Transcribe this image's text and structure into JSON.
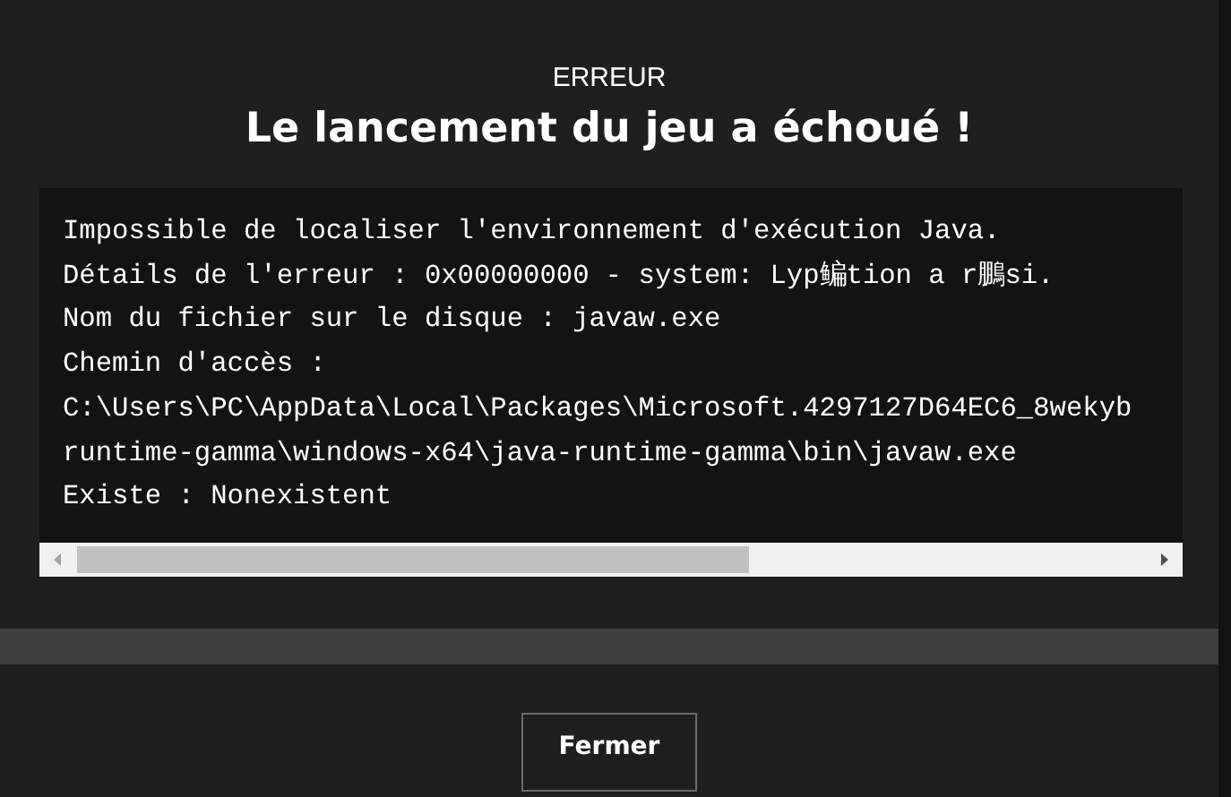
{
  "dialog": {
    "overline": "ERREUR",
    "title": "Le lancement du jeu a échoué !",
    "details": [
      "Impossible de localiser l'environnement d'exécution Java.",
      "Détails de l'erreur : 0x00000000 - system: Lyp鳊tion a r鵬si.",
      "Nom du fichier sur le disque : javaw.exe",
      "Chemin d'accès :",
      "C:\\Users\\PC\\AppData\\Local\\Packages\\Microsoft.4297127D64EC6_8wekyb",
      "runtime-gamma\\windows-x64\\java-runtime-gamma\\bin\\javaw.exe",
      "Existe : Nonexistent"
    ],
    "close_button": "Fermer"
  }
}
